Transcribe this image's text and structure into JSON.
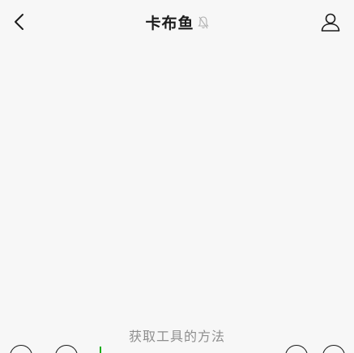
{
  "header": {
    "title": "卡布鱼"
  },
  "chat": {
    "hint": "获取工具的方法"
  },
  "icons": {
    "back": "chevron-left-icon",
    "mute": "bell-off-icon",
    "profile": "person-icon",
    "voice": "voice-icon",
    "emoji": "emoji-icon",
    "plus": "plus-icon"
  },
  "colors": {
    "background": "#f7f7f7",
    "text": "#1b1b1b",
    "hint": "#8e8e8e",
    "cursor": "#1aad19"
  }
}
